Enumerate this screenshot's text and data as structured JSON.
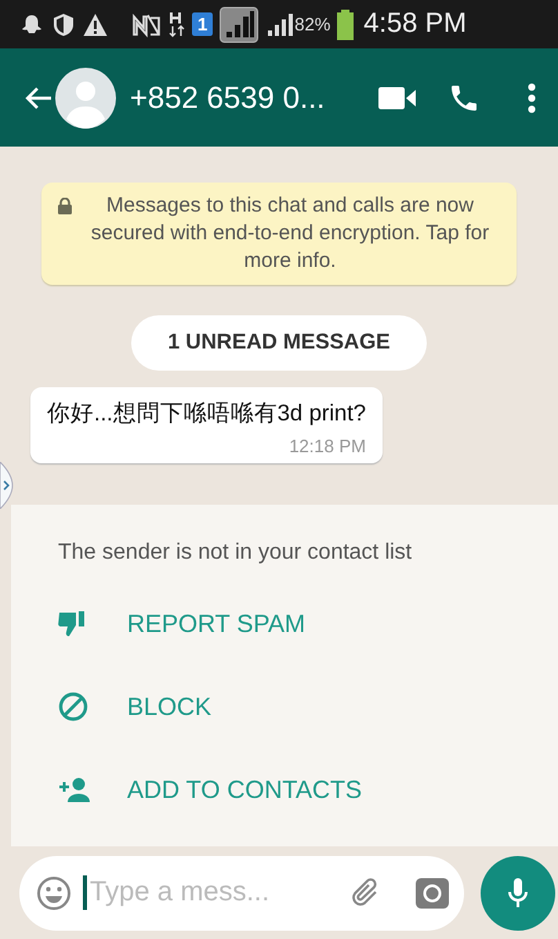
{
  "status_bar": {
    "battery_text": "82%",
    "time": "4:58 PM",
    "sim_badge": "1"
  },
  "app_bar": {
    "title": "+852 6539 0..."
  },
  "encryption_notice": "Messages to this chat and calls are now secured with end-to-end encryption. Tap for more info.",
  "unread_banner": "1 UNREAD MESSAGE",
  "messages": [
    {
      "text": "你好...想問下喺唔喺有3d print?",
      "time": "12:18 PM"
    }
  ],
  "contact_prompt": {
    "text": "The sender is not in your contact list",
    "actions": [
      {
        "kind": "report",
        "label": "REPORT SPAM"
      },
      {
        "kind": "block",
        "label": "BLOCK"
      },
      {
        "kind": "add",
        "label": "ADD TO CONTACTS"
      }
    ]
  },
  "composer": {
    "placeholder": "Type a mess..."
  }
}
